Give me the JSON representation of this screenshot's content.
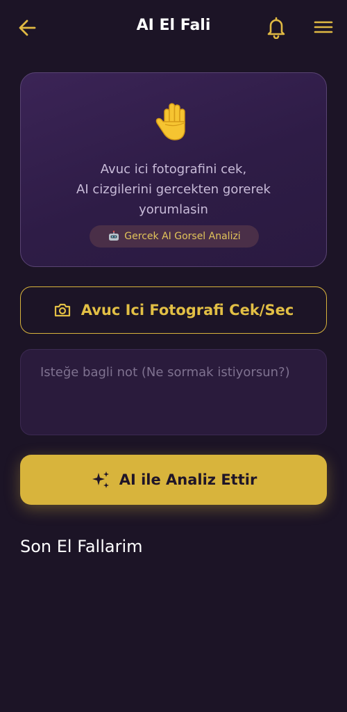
{
  "header": {
    "title": "AI El Fali",
    "back_icon": "arrow-left-icon",
    "bell_icon": "bell-icon",
    "menu_icon": "hamburger-menu-icon"
  },
  "hero": {
    "emoji_icon": "raised-hand-icon",
    "lines": [
      "Avuc ici fotografini cek,",
      "AI cizgilerini gercekten gorerek",
      "yorumlasin"
    ],
    "badge_icon": "robot-icon",
    "badge_label": "Gercek AI Gorsel Analizi"
  },
  "photo_button": {
    "icon": "camera-icon",
    "label": "Avuc Ici Fotografi Cek/Sec"
  },
  "note": {
    "placeholder": "Isteğe bagli not (Ne sormak istiyorsun?)",
    "value": ""
  },
  "analyze_button": {
    "icon": "sparkles-icon",
    "label": "AI ile Analiz Ettir"
  },
  "recent": {
    "title": "Son El Fallarim"
  },
  "colors": {
    "background": "#1c1426",
    "accent": "#d8b43c",
    "card": "#2e1c46"
  }
}
